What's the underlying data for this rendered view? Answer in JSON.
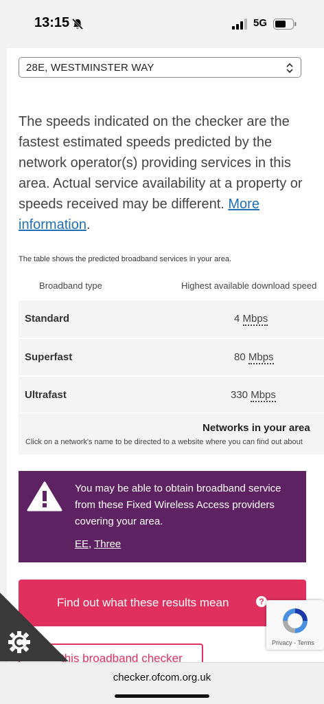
{
  "status_bar": {
    "time": "13:15",
    "network": "5G"
  },
  "address_select": {
    "value": "28E, WESTMINSTER WAY"
  },
  "intro": {
    "text": "The speeds indicated on the checker are the fastest estimated speeds predicted by the network operator(s) providing services in this area. Actual service availability at a property or speeds received may be different. ",
    "link": "More information",
    "suffix": "."
  },
  "table": {
    "note": "The table shows the predicted broadband services in your area.",
    "headers": {
      "type": "Broadband type",
      "speed": "Highest available download speed"
    },
    "rows": [
      {
        "type": "Standard",
        "value": "4",
        "unit": "Mbps"
      },
      {
        "type": "Superfast",
        "value": "80",
        "unit": "Mbps"
      },
      {
        "type": "Ultrafast",
        "value": "330",
        "unit": "Mbps"
      }
    ]
  },
  "networks": {
    "title": "Networks in your area",
    "subtitle": "Click on a network's name to be directed to a website where you can find out about"
  },
  "fwa_notice": {
    "message": "You may be able to obtain broadband service from these Fixed Wireless Access providers covering your area.",
    "providers": [
      "EE",
      "Three"
    ],
    "separator": ", ",
    "color": "#5e2162"
  },
  "buttons": {
    "results": "Find out what these results mean",
    "results_help": "?",
    "checker": "this broadband checker",
    "accent": "#e0305e"
  },
  "recaptcha": {
    "terms": "Privacy - Terms"
  },
  "browser": {
    "url": "checker.ofcom.org.uk"
  }
}
